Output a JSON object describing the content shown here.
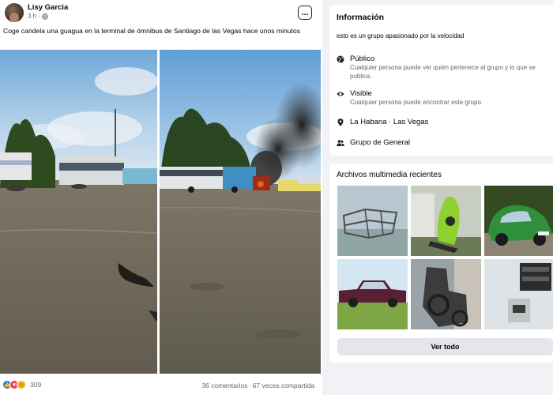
{
  "post": {
    "author": "Lisy Garcia",
    "time": "3 h",
    "more_icon": "...",
    "text": "Coge candela una guagua en la terminal de ómnibus de Santiago de las Vegas hace unos minutos",
    "reactions": {
      "icons": [
        "like-icon",
        "love-icon",
        "haha-icon"
      ],
      "count": "309"
    },
    "comments": "36 comentarios",
    "shares": "67 veces compartida"
  },
  "info": {
    "title": "Información",
    "description": "esto es un grupo apasionado por la velocidad",
    "items": [
      {
        "icon": "globe-icon",
        "title": "Público",
        "subtitle": "Cualquier persona puede ver quién pertenece al grupo y lo que se publica."
      },
      {
        "icon": "eye-icon",
        "title": "Visible",
        "subtitle": "Cualquier persona puede encontrar este grupo."
      },
      {
        "icon": "location-pin-icon",
        "title": "La Habana · Las Vegas"
      },
      {
        "icon": "people-icon",
        "title": "Grupo de General"
      }
    ]
  },
  "media": {
    "title": "Archivos multimedia recientes",
    "see_all": "Ver todo"
  },
  "colors": {
    "background": "#f0f2f5",
    "card": "#ffffff",
    "accent": "#1877f2",
    "secondary_text": "#65676b"
  }
}
